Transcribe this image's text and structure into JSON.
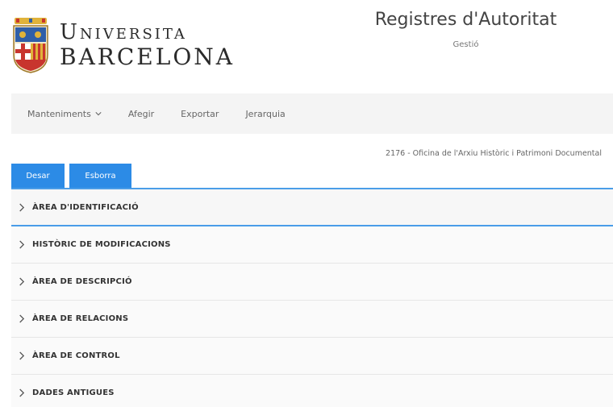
{
  "header": {
    "logo_line1": "Universita",
    "logo_line2": "BARCELONA",
    "title": "Registres d'Autoritat",
    "subtitle": "Gestió"
  },
  "nav": {
    "items": [
      {
        "label": "Manteniments",
        "has_dropdown": true,
        "icon": "chevron-down-icon"
      },
      {
        "label": "Afegir"
      },
      {
        "label": "Exportar"
      },
      {
        "label": "Jerarquia"
      }
    ]
  },
  "record": {
    "label": "2176 - Oficina de l'Arxiu Històric i Patrimoni Documental"
  },
  "buttons": {
    "save_label": "Desar",
    "delete_label": "Esborra"
  },
  "accordion": {
    "icon": "chevron-right-icon",
    "items": [
      {
        "label": "ÀREA D'IDENTIFICACIÓ"
      },
      {
        "label": "HISTÒRIC DE MODIFICACIONS"
      },
      {
        "label": "ÀREA DE DESCRIPCIÓ"
      },
      {
        "label": "ÀREA DE RELACIONS"
      },
      {
        "label": "ÀREA DE CONTROL"
      },
      {
        "label": "DADES ANTIGUES"
      }
    ]
  },
  "colors": {
    "accent": "#2c8be6",
    "navbar_bg": "#f4f4f4",
    "shield_blue": "#2f5fa8",
    "shield_red": "#c8352e",
    "shield_gold": "#e0b33a"
  }
}
